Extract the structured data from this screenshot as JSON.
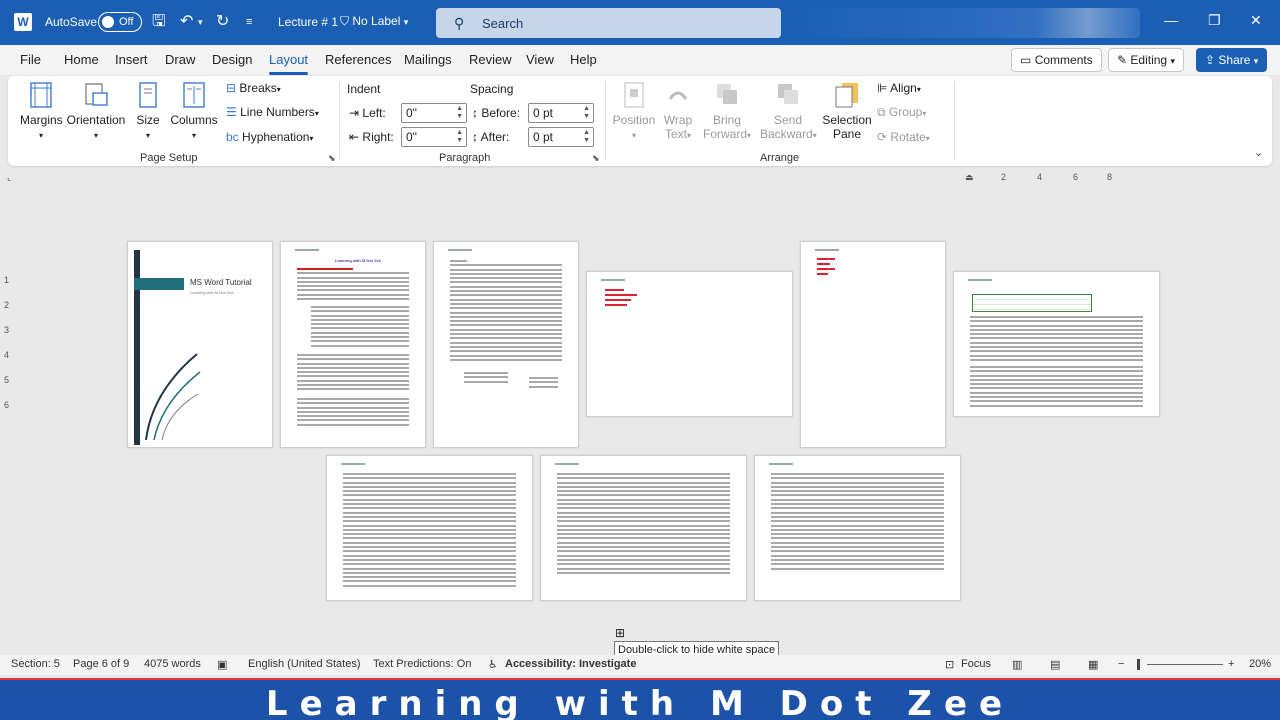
{
  "titlebar": {
    "autosave_label": "AutoSave",
    "autosave_state": "Off",
    "doc_title": "Lecture # 1",
    "sensitivity_label": "No Label",
    "search_placeholder": "Search"
  },
  "tabs": [
    "File",
    "Home",
    "Insert",
    "Draw",
    "Design",
    "Layout",
    "References",
    "Mailings",
    "Review",
    "View",
    "Help"
  ],
  "active_tab": "Layout",
  "right_buttons": {
    "comments": "Comments",
    "editing": "Editing",
    "share": "Share"
  },
  "ribbon": {
    "page_setup": {
      "margins": "Margins",
      "orientation": "Orientation",
      "size": "Size",
      "columns": "Columns",
      "breaks": "Breaks",
      "line_numbers": "Line Numbers",
      "hyphenation": "Hyphenation",
      "group_label": "Page Setup"
    },
    "paragraph": {
      "indent_label": "Indent",
      "spacing_label": "Spacing",
      "left_label": "Left:",
      "right_label": "Right:",
      "before_label": "Before:",
      "after_label": "After:",
      "left_value": "0\"",
      "right_value": "0\"",
      "before_value": "0 pt",
      "after_value": "0 pt",
      "group_label": "Paragraph"
    },
    "arrange": {
      "position": "Position",
      "wrap_text_1": "Wrap",
      "wrap_text_2": "Text",
      "bring_forward_1": "Bring",
      "bring_forward_2": "Forward",
      "send_backward_1": "Send",
      "send_backward_2": "Backward",
      "selection_pane_1": "Selection",
      "selection_pane_2": "Pane",
      "align": "Align",
      "group": "Group",
      "rotate": "Rotate",
      "group_label": "Arrange"
    }
  },
  "ruler_ticks": [
    "2",
    "4",
    "6",
    "8"
  ],
  "vruler_ticks": [
    "1",
    "2",
    "3",
    "4",
    "5",
    "6"
  ],
  "pages": {
    "cover_title": "MS Word Tutorial",
    "cover_subtitle": "Learning with M Dot Zee",
    "page2_heading": "Learning with M Dot Zee"
  },
  "statusbar": {
    "section": "Section: 5",
    "page": "Page 6 of 9",
    "words": "4075 words",
    "language": "English (United States)",
    "text_predictions": "Text Predictions: On",
    "accessibility": "Accessibility: Investigate",
    "focus": "Focus",
    "zoom": "20%"
  },
  "tooltip": "Double-click to hide white space",
  "banner": "Learning with M Dot Zee"
}
